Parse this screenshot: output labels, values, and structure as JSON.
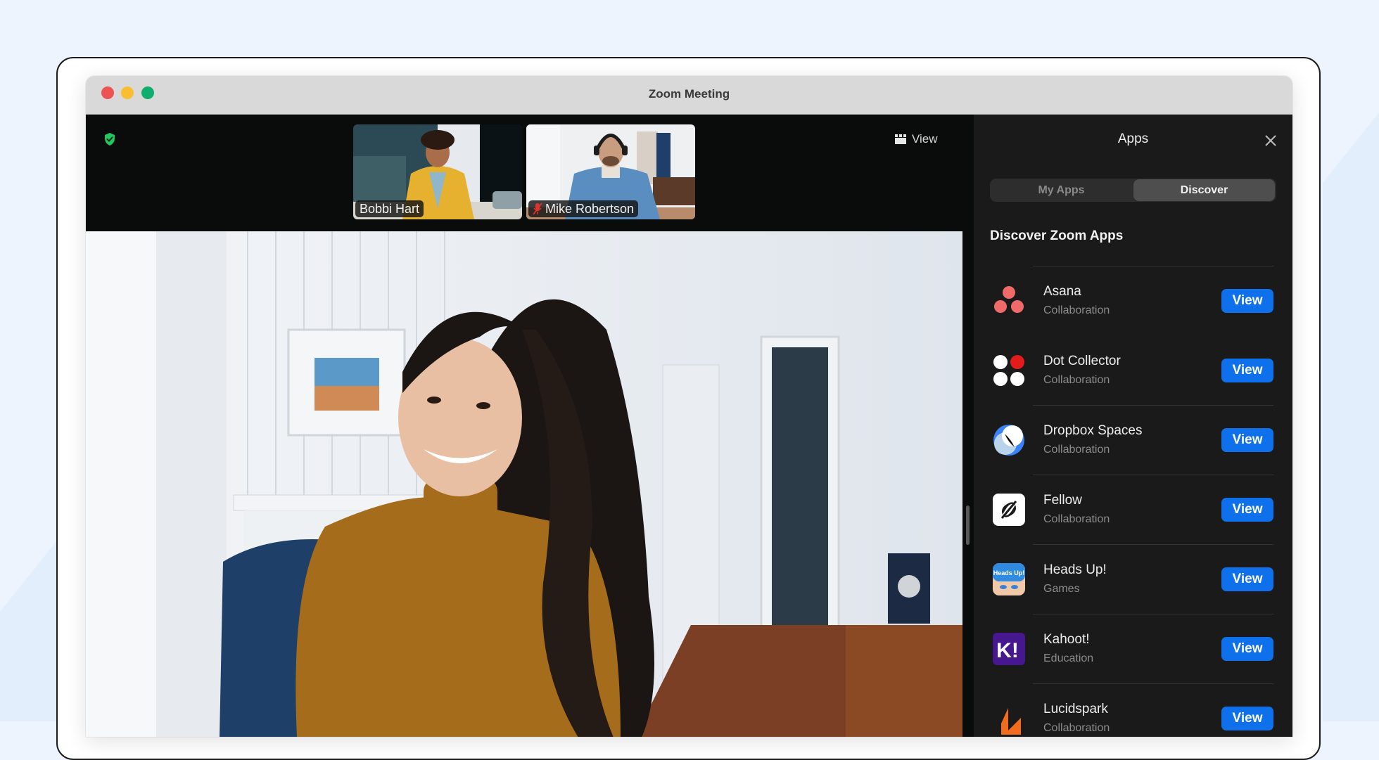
{
  "window": {
    "title": "Zoom Meeting"
  },
  "meeting": {
    "encryption_icon": "shield-check-icon",
    "view_label": "View",
    "participants": [
      {
        "name": "Bobbi Hart",
        "muted": false
      },
      {
        "name": "Mike Robertson",
        "muted": true
      }
    ],
    "active_speaker": "main video feed"
  },
  "apps_panel": {
    "title": "Apps",
    "tabs": [
      {
        "label": "My Apps",
        "selected": false
      },
      {
        "label": "Discover",
        "selected": true
      }
    ],
    "section_heading": "Discover Zoom Apps",
    "view_button_label": "View",
    "apps": [
      {
        "name": "Asana",
        "category": "Collaboration",
        "icon": "asana-icon"
      },
      {
        "name": "Dot Collector",
        "category": "Collaboration",
        "icon": "dot-collector-icon"
      },
      {
        "name": "Dropbox Spaces",
        "category": "Collaboration",
        "icon": "dropbox-spaces-icon"
      },
      {
        "name": "Fellow",
        "category": "Collaboration",
        "icon": "fellow-icon"
      },
      {
        "name": "Heads Up!",
        "category": "Games",
        "icon": "heads-up-icon"
      },
      {
        "name": "Kahoot!",
        "category": "Education",
        "icon": "kahoot-icon"
      },
      {
        "name": "Lucidspark",
        "category": "Collaboration",
        "icon": "lucidspark-icon"
      }
    ]
  },
  "colors": {
    "accent_blue": "#0e71eb",
    "panel_bg": "#1a1a1a",
    "meeting_bg": "#0a0b0b",
    "shield_green": "#22c55e"
  }
}
